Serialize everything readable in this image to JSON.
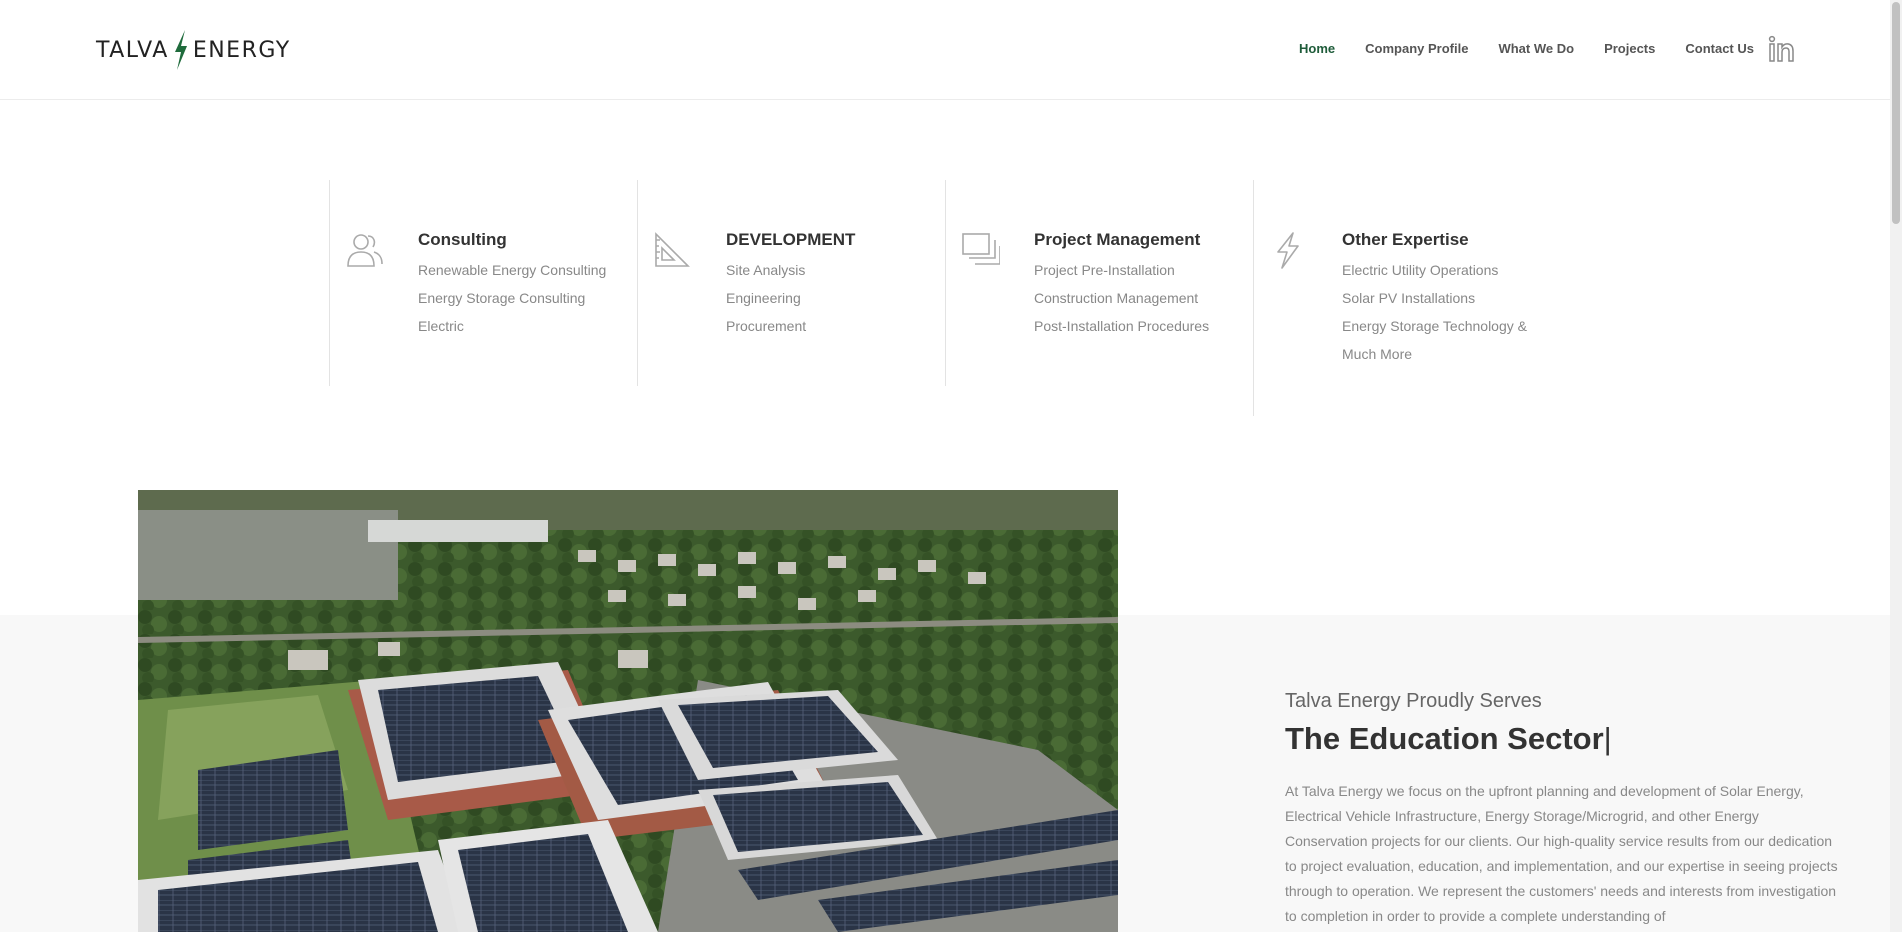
{
  "header": {
    "logo_left": "TALVA",
    "logo_right": "ENERGY",
    "logo_bolt_color": "#1f6b3c",
    "nav": [
      {
        "label": "Home",
        "active": true
      },
      {
        "label": "Company Profile",
        "active": false
      },
      {
        "label": "What We Do",
        "active": false
      },
      {
        "label": "Projects",
        "active": false
      },
      {
        "label": "Contact Us",
        "active": false
      }
    ],
    "social_icon": "linkedin-icon"
  },
  "services": [
    {
      "icon": "users-icon",
      "title": "Consulting",
      "items": [
        "Renewable Energy Consulting",
        "Energy Storage Consulting",
        "Electric"
      ]
    },
    {
      "icon": "set-square-icon",
      "title": "DEVELOPMENT",
      "items": [
        "Site Analysis",
        "Engineering",
        "Procurement"
      ]
    },
    {
      "icon": "documents-icon",
      "title": "Project Management",
      "items": [
        "Project Pre-Installation",
        "Construction Management",
        "Post-Installation Procedures"
      ]
    },
    {
      "icon": "lightning-icon",
      "title": "Other Expertise",
      "items": [
        "Electric Utility Operations",
        "Solar PV Installations",
        "Energy Storage Technology &",
        "Much More"
      ]
    }
  ],
  "feature": {
    "subtitle": "Talva Energy Proudly Serves",
    "title": "The Education Sector",
    "cursor": "|",
    "body": "At Talva Energy we focus on the upfront planning and development of Solar Energy, Electrical Vehicle Infrastructure, Energy Storage/Microgrid, and other Energy Conservation projects for our clients. Our high-quality service results from our dedication to project evaluation, education, and implementation, and our expertise in seeing projects through to operation. We represent the customers' needs and interests from investigation to completion in order to provide a complete understanding of",
    "image": "aerial-photo-school-solar-panels"
  },
  "colors": {
    "accent": "#1f5c3a",
    "band": "#f8f8f8"
  }
}
